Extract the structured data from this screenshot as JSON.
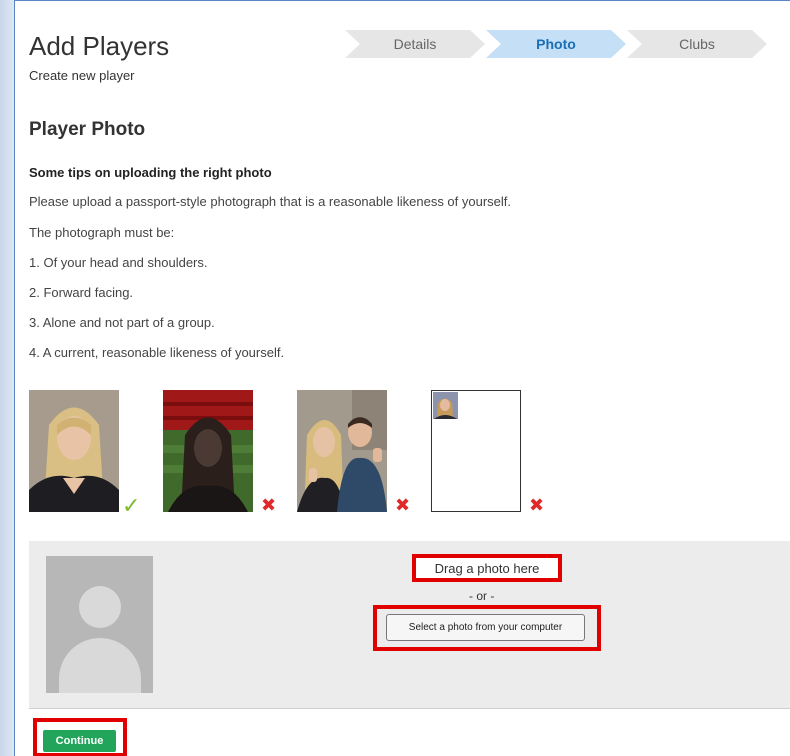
{
  "header": {
    "title": "Add Players",
    "subtitle": "Create new player"
  },
  "stepper": {
    "steps": [
      {
        "label": "Details",
        "active": false
      },
      {
        "label": "Photo",
        "active": true
      },
      {
        "label": "Clubs",
        "active": false
      }
    ]
  },
  "section": {
    "title": "Player Photo",
    "tips_heading": "Some tips on uploading the right photo",
    "intro": "Please upload a passport-style photograph that is a reasonable likeness of yourself.",
    "must_be": "The photograph must be:",
    "rules": [
      "1. Of your head and shoulders.",
      "2. Forward facing.",
      "3. Alone and not part of a group.",
      "4. A current, reasonable likeness of yourself."
    ]
  },
  "examples": [
    {
      "icon": "check-icon",
      "mark": "✓",
      "status": "good"
    },
    {
      "icon": "cross-icon",
      "mark": "✖",
      "status": "bad"
    },
    {
      "icon": "cross-icon",
      "mark": "✖",
      "status": "bad"
    },
    {
      "icon": "cross-icon",
      "mark": "✖",
      "status": "bad"
    }
  ],
  "upload": {
    "drag_label": "Drag a photo here",
    "or_label": "- or -",
    "select_label": "Select a photo from your computer"
  },
  "actions": {
    "continue_label": "Continue"
  },
  "colors": {
    "accent_green": "#22a55a",
    "highlight_red": "#e00000",
    "active_step": "#c4dff6"
  }
}
